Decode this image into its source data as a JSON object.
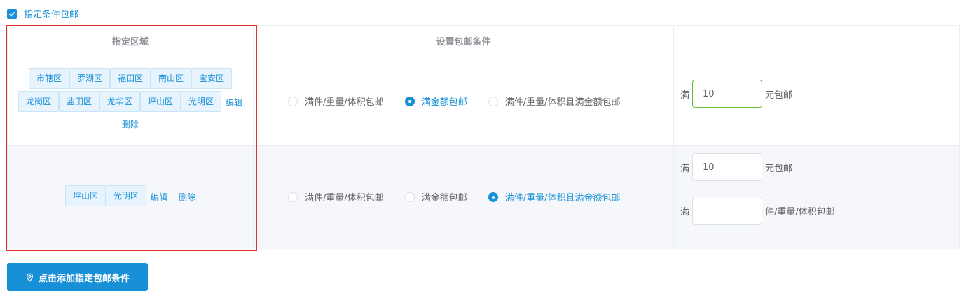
{
  "top_checkbox": {
    "label": "指定条件包邮",
    "checked": true
  },
  "table": {
    "headers": {
      "region": "指定区域",
      "condition": "设置包邮条件",
      "value": ""
    },
    "rows": [
      {
        "regions": [
          "市辖区",
          "罗湖区",
          "福田区",
          "南山区",
          "宝安区",
          "龙岗区",
          "盐田区",
          "龙华区",
          "坪山区",
          "光明区"
        ],
        "edit_label": "编辑",
        "delete_label": "删除",
        "radio_options": [
          "满件/重量/体积包邮",
          "满金额包邮",
          "满件/重量/体积且满金额包邮"
        ],
        "selected_option": "满金额包邮",
        "amount": {
          "prefix": "满",
          "value": "10",
          "suffix": "元包邮"
        }
      },
      {
        "regions": [
          "坪山区",
          "光明区"
        ],
        "edit_label": "编辑",
        "delete_label": "删除",
        "radio_options": [
          "满件/重量/体积包邮",
          "满金额包邮",
          "满件/重量/体积且满金额包邮"
        ],
        "selected_option": "满件/重量/体积且满金额包邮",
        "amount": {
          "prefix": "满",
          "value": "10",
          "suffix": "元包邮"
        },
        "quantity": {
          "prefix": "满",
          "value": "",
          "suffix": "件/重量/体积包邮"
        }
      }
    ]
  },
  "add_button": {
    "label": "点击添加指定包邮条件",
    "icon": "location-pin-icon"
  },
  "colors": {
    "accent": "#1890d8",
    "selection_border": "#e0312f",
    "focus_border": "#67c23a"
  }
}
